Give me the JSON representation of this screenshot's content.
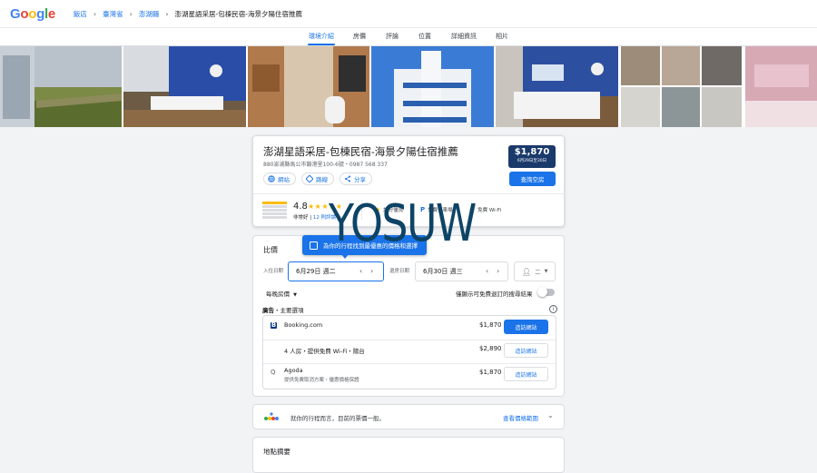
{
  "topbar": {
    "logo_text": "Google",
    "breadcrumbs": [
      "飯店",
      "臺灣省",
      "澎湖縣",
      "澎湖星語采居-包棟民宿-海景夕陽住宿推薦"
    ]
  },
  "tabs": [
    {
      "label": "環境介紹",
      "active": true
    },
    {
      "label": "房價",
      "active": false
    },
    {
      "label": "評論",
      "active": false
    },
    {
      "label": "位置",
      "active": false
    },
    {
      "label": "詳細資訊",
      "active": false
    },
    {
      "label": "相片",
      "active": false
    }
  ],
  "hotel": {
    "name": "澎湖星語采居-包棟民宿-海景夕陽住宿推薦",
    "address": "880澎湖縣馬公市鎖港里100-6號・0987 568 337",
    "actions": {
      "website": "網站",
      "directions": "路線",
      "share": "分享"
    },
    "price": "$1,870",
    "price_dates": "6月29日至30日",
    "check_button": "查詢空房",
    "rating": "4.8",
    "stars": "★★★★★",
    "rating_label": "非常好",
    "review_count": "12 則評論",
    "amenities": [
      "評分優良",
      "免費停車場",
      "免費 Wi-Fi"
    ]
  },
  "pricing": {
    "title": "比價",
    "tooltip": "為你的行程找到最優惠的價格和選擇",
    "checkin_label": "入住日期",
    "checkin_value": "6月29日 週二",
    "checkout_label": "退房日期",
    "checkout_value": "6月30日 週三",
    "guests": "二",
    "nightly_label": "每晚房價",
    "toggle_label": "僅顯示可免費退訂的搜尋結果",
    "ad_prefix": "廣告",
    "ad_label": "・主要選項",
    "offers": [
      {
        "name": "Booking.com",
        "desc": "",
        "price": "$1,870",
        "button": "造訪網站",
        "primary": true
      },
      {
        "name": "",
        "desc": "4 人房・提供免費 Wi-Fi・陽台",
        "price": "$2,890",
        "button": "造訪網站",
        "primary": false
      },
      {
        "name": "Agoda",
        "desc": "提供免費取消方案・優惠價格保證",
        "price": "$1,870",
        "button": "造訪網站",
        "primary": false
      }
    ]
  },
  "tip": {
    "text": "就你的行程而言，目前的票價一般。",
    "link": "查看價格範圍"
  },
  "map": {
    "title": "地點摘要"
  },
  "watermark": "YOSUW",
  "colors": {
    "accent": "#1a73e8",
    "price_bg": "#1a3a6b",
    "star": "#fbbc04",
    "watermark": "#0d4466"
  }
}
